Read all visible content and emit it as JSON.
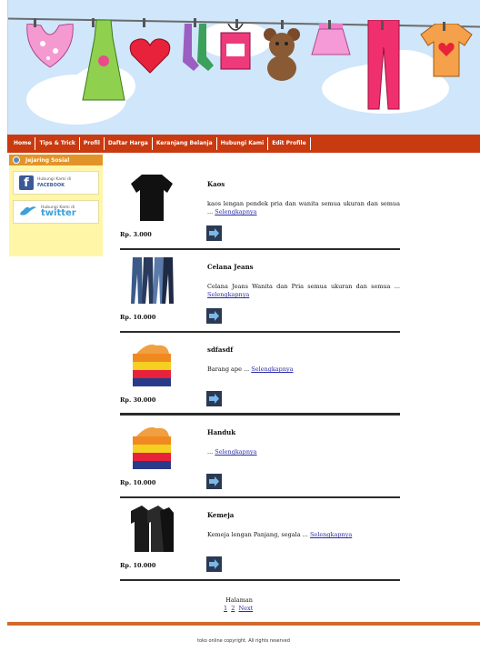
{
  "nav": {
    "items": [
      "Home",
      "Tips & Trick",
      "Profil",
      "Daftar Harga",
      "Keranjang Belanja",
      "Hubungi Kami",
      "Edit Profile"
    ]
  },
  "sidebar": {
    "title": "Jejaring Sosial",
    "facebook": {
      "line1": "Hubungi Kami di",
      "line2": "FACEBOOK"
    },
    "twitter": {
      "line1": "Hubungi Kami di",
      "brand": "twitter"
    }
  },
  "products": [
    {
      "title": "Kaos",
      "price": "Rp. 3.000",
      "desc": "kaos lengan pendek pria dan wanita semua ukuran dan semua ...",
      "link": "Selengkapnya"
    },
    {
      "title": "Celana Jeans",
      "price": "Rp. 10.000",
      "desc": "Celana Jeans Wanita dan Pria semua ukuran dan semua ...",
      "link": "Selengkapnya"
    },
    {
      "title": "sdfasdf",
      "price": "Rp. 30.000",
      "desc": "Barang ape ...",
      "link": "Selengkapnya"
    },
    {
      "title": "Handuk",
      "price": "Rp. 10.000",
      "desc": "...",
      "link": "Selengkapnya"
    },
    {
      "title": "Kemeja",
      "price": "Rp. 10.000",
      "desc": "Kemeja lengan Panjang, segala ...",
      "link": "Selengkapnya"
    }
  ],
  "pagination": {
    "label": "Halaman",
    "pages": [
      "1",
      "2"
    ],
    "next": "Next"
  },
  "footer": {
    "text": "toko online copyright. All rights reserved"
  },
  "colors": {
    "nav_bg": "#c93a10",
    "sidebar_bg": "#fff6a8",
    "sidebar_header": "#e39428",
    "banner_sky": "#cfe6fb"
  }
}
